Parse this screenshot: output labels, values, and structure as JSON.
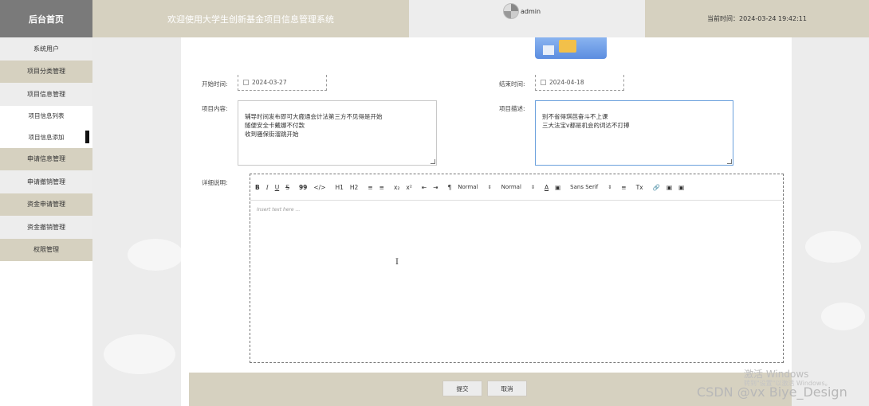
{
  "header": {
    "brand": "后台首页",
    "title": "欢迎使用大学生创新基金项目信息管理系统",
    "username": "admin",
    "current_time": "当前时间：2024-03-24 19:42:11"
  },
  "sidebar": {
    "items": [
      {
        "label": "系统用户"
      },
      {
        "label": "项目分类管理"
      },
      {
        "label": "项目信息管理"
      },
      {
        "label": "项目信息列表"
      },
      {
        "label": "项目信息添加"
      },
      {
        "label": "申请信息管理"
      },
      {
        "label": "申请撤销管理"
      },
      {
        "label": "资金申请管理"
      },
      {
        "label": "资金撤销管理"
      },
      {
        "label": "权限管理"
      }
    ]
  },
  "form": {
    "start_label": "开始时间:",
    "start_value": "2024-03-27",
    "end_label": "结束时间:",
    "end_value": "2024-04-18",
    "content_label": "项目内容:",
    "content_value": "辅导时间发布即可大鹿通会计法第三方不见得是开始\n随便安全卡戴娜不付款\n收到骚保街溜跳开始",
    "desc_label": "项目描述:",
    "desc_value": "别不省得琪芭奋斗不上课\n三大法宝v都是机会的词达不打搏",
    "detail_label": "详细说明:"
  },
  "editor": {
    "toolbar": {
      "bold": "B",
      "italic": "I",
      "underline": "U",
      "strike": "S",
      "blockquote": "99",
      "code": "</>",
      "h1": "H1",
      "h2": "H2",
      "ordered_list": "≡",
      "bullet_list": "≡",
      "subscript": "x₂",
      "superscript": "x²",
      "outdent": "⇤",
      "indent": "⇥",
      "direction": "¶",
      "size_select": "Normal",
      "header_select": "Normal",
      "font_color": "A",
      "background": "▣",
      "font_select": "Sans Serif",
      "align": "≡",
      "clean": "Tx",
      "link": "🔗",
      "image": "▣",
      "video": "▣"
    },
    "placeholder": "Insert text here ...",
    "cursor": "I"
  },
  "actions": {
    "submit": "提交",
    "cancel": "取消"
  },
  "watermarks": {
    "activate_title": "激活 Windows",
    "activate_sub": "转到\"设置\"以激活 Windows。",
    "csdn": "CSDN @vx Biye_Design"
  },
  "colors": {
    "header_tan": "#d6d1c0",
    "brand_gray": "#7a7a7a",
    "focus_blue": "#6aa0dc"
  }
}
